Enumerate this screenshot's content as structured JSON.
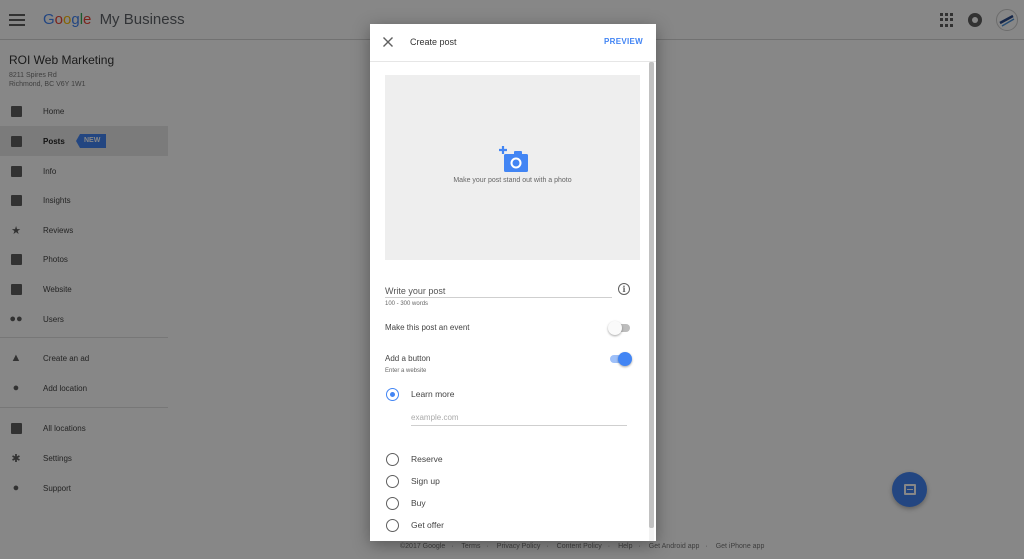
{
  "app": {
    "logo_letters": [
      "G",
      "o",
      "o",
      "g",
      "l",
      "e"
    ],
    "product_name": "My Business"
  },
  "business": {
    "name": "ROI Web Marketing",
    "address_line1": "8211 Spires Rd",
    "address_line2": "Richmond, BC V6Y 1W1"
  },
  "sidebar": {
    "items": [
      {
        "label": "Home",
        "icon": "dashboard-icon"
      },
      {
        "label": "Posts",
        "icon": "posts-icon",
        "badge": "NEW",
        "active": true
      },
      {
        "label": "Info",
        "icon": "storefront-icon"
      },
      {
        "label": "Insights",
        "icon": "insights-icon"
      },
      {
        "label": "Reviews",
        "icon": "star-icon"
      },
      {
        "label": "Photos",
        "icon": "photos-icon"
      },
      {
        "label": "Website",
        "icon": "website-icon"
      },
      {
        "label": "Users",
        "icon": "users-icon"
      },
      {
        "label": "Create an ad",
        "icon": "adwords-icon"
      },
      {
        "label": "Add location",
        "icon": "location-pin-icon"
      },
      {
        "label": "All locations",
        "icon": "buildings-icon"
      },
      {
        "label": "Settings",
        "icon": "gear-icon"
      },
      {
        "label": "Support",
        "icon": "help-icon"
      }
    ]
  },
  "footer": {
    "links": [
      "©2017 Google",
      "Terms",
      "Privacy Policy",
      "Content Policy",
      "Help",
      "Get Android app",
      "Get iPhone app"
    ],
    "separator": "·"
  },
  "dialog": {
    "title": "Create post",
    "preview_label": "PREVIEW",
    "photo_caption": "Make your post stand out with a photo",
    "post_field_label": "Write your post",
    "post_helper": "100 - 300 words",
    "info_glyph": "i",
    "event_label": "Make this post an event",
    "event_enabled": false,
    "button_label": "Add a button",
    "button_helper": "Enter a website",
    "button_enabled": true,
    "options": [
      {
        "label": "Learn more",
        "checked": true
      },
      {
        "label": "Reserve",
        "checked": false
      },
      {
        "label": "Sign up",
        "checked": false
      },
      {
        "label": "Buy",
        "checked": false
      },
      {
        "label": "Get offer",
        "checked": false
      }
    ],
    "url_placeholder": "example.com",
    "url_value": ""
  },
  "colors": {
    "accent": "#4285f4",
    "scrim": "rgba(0,0,0,0.47)"
  }
}
